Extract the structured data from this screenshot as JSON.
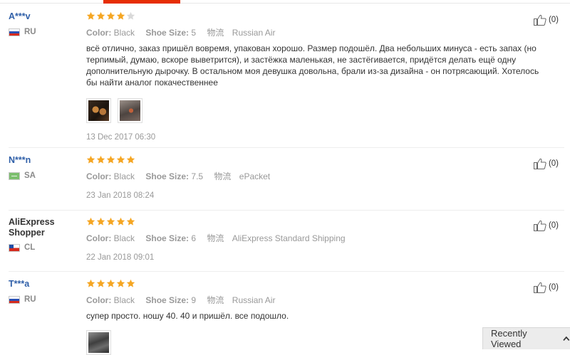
{
  "labels": {
    "color": "Color:",
    "shoe_size": "Shoe Size:",
    "shipping_glyph": "物流"
  },
  "colors": {
    "username": "#2f5fa8",
    "star_filled": "#f5a623",
    "star_empty": "#d9d9d9",
    "accent": "#e62e04",
    "muted": "#999999"
  },
  "reviews": [
    {
      "user": "A***v",
      "country": "RU",
      "flag": "ru-flag",
      "rating": 4,
      "color": "Black",
      "size": "5",
      "shipping": "Russian Air",
      "text": "всё отлично, заказ пришёл вовремя, упакован хорошо. Размер подошёл. Два небольших минуса - есть запах (но терпимый, думаю, вскоре выветрится), и застёжка маленькая, не застёгивается, придётся делать ещё одну дополнительную дырочку. В остальном моя девушка довольна, брали из-за дизайна - он потрясающий. Хотелось бы найти аналог покачественнее",
      "photos": 2,
      "date": "13 Dec 2017 06:30",
      "helpful": "(0)"
    },
    {
      "user": "N***n",
      "country": "SA",
      "flag": "sa-flag",
      "rating": 5,
      "color": "Black",
      "size": "7.5",
      "shipping": "ePacket",
      "text": "",
      "photos": 0,
      "date": "23 Jan 2018 08:24",
      "helpful": "(0)"
    },
    {
      "user": "AliExpress Shopper",
      "country": "CL",
      "flag": "cl-flag",
      "rating": 5,
      "color": "Black",
      "size": "6",
      "shipping": "AliExpress Standard Shipping",
      "text": "",
      "photos": 0,
      "date": "22 Jan 2018 09:01",
      "helpful": "(0)"
    },
    {
      "user": "T***a",
      "country": "RU",
      "flag": "ru-flag",
      "rating": 5,
      "color": "Black",
      "size": "9",
      "shipping": "Russian Air",
      "text": "супер просто. ношу 40. 40 и пришёл. все подошло.",
      "photos": 1,
      "date": "",
      "helpful": "(0)"
    }
  ],
  "recently_viewed": {
    "label": "Recently Viewed",
    "icon": "chevron-up-icon"
  }
}
